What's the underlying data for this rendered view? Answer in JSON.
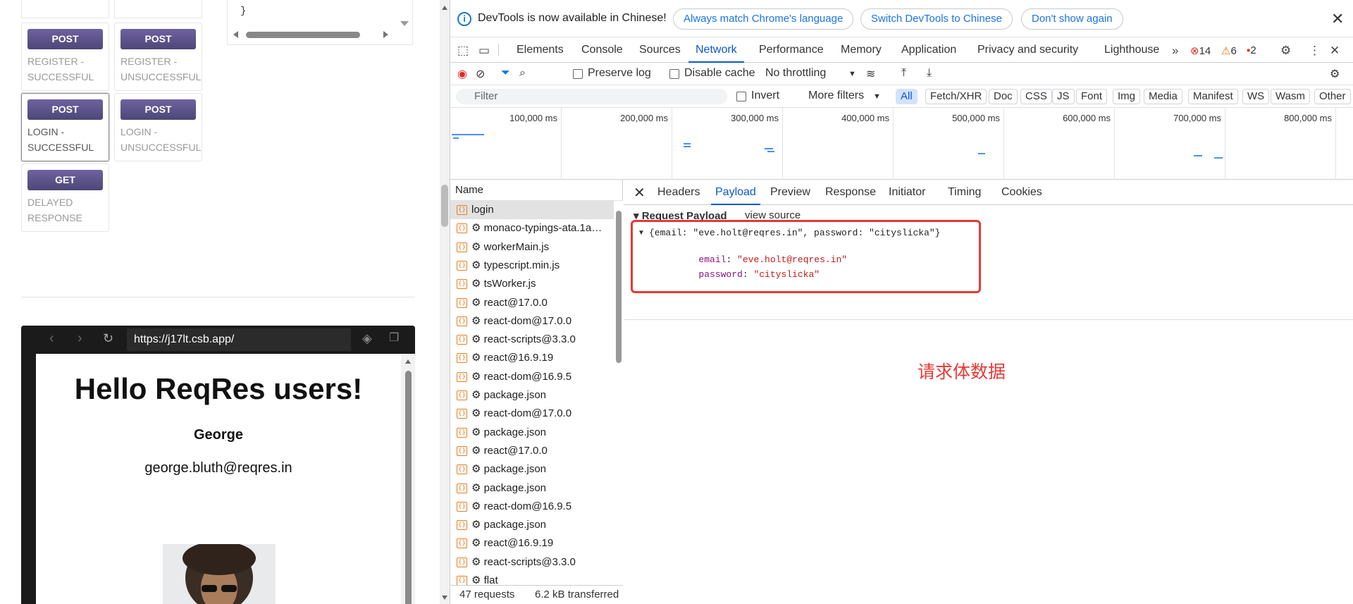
{
  "left_page": {
    "code_tail": "}",
    "endpoints": [
      {
        "method": "POST",
        "label": "REGISTER - SUCCESSFUL"
      },
      {
        "method": "POST",
        "label": "REGISTER - UNSUCCESSFUL"
      },
      {
        "method": "POST",
        "label": "LOGIN - SUCCESSFUL"
      },
      {
        "method": "POST",
        "label": "LOGIN - UNSUCCESSFUL"
      },
      {
        "method": "GET",
        "label": "DELAYED RESPONSE"
      }
    ],
    "sandbox": {
      "url": "https://j17lt.csb.app/",
      "title": "Hello ReqRes users!",
      "user_name": "George",
      "user_email": "george.bluth@reqres.in"
    }
  },
  "devtools": {
    "infobar": {
      "text": "DevTools is now available in Chinese!",
      "btn_match": "Always match Chrome's language",
      "btn_switch": "Switch DevTools to Chinese",
      "btn_dont_show": "Don't show again"
    },
    "tabs": [
      "Elements",
      "Console",
      "Sources",
      "Network",
      "Performance",
      "Memory",
      "Application",
      "Privacy and security",
      "Lighthouse"
    ],
    "active_tab": "Network",
    "counts": {
      "errors": "14",
      "warnings": "6",
      "issues": "2"
    },
    "toolbar": {
      "preserve_log": "Preserve log",
      "disable_cache": "Disable cache",
      "throttling": "No throttling"
    },
    "filter": {
      "placeholder": "Filter",
      "invert": "Invert",
      "more_filters": "More filters",
      "types": [
        "All",
        "Fetch/XHR",
        "Doc",
        "CSS",
        "JS",
        "Font",
        "Img",
        "Media",
        "Manifest",
        "WS",
        "Wasm",
        "Other"
      ]
    },
    "overview_ticks": [
      "100,000 ms",
      "200,000 ms",
      "300,000 ms",
      "400,000 ms",
      "500,000 ms",
      "600,000 ms",
      "700,000 ms",
      "800,000 ms"
    ],
    "name_header": "Name",
    "requests": [
      "login",
      "⚙ monaco-typings-ata.1a…",
      "⚙ workerMain.js",
      "⚙ typescript.min.js",
      "⚙ tsWorker.js",
      "⚙ react@17.0.0",
      "⚙ react-dom@17.0.0",
      "⚙ react-scripts@3.3.0",
      "⚙ react@16.9.19",
      "⚙ react-dom@16.9.5",
      "⚙ package.json",
      "⚙ react-dom@17.0.0",
      "⚙ package.json",
      "⚙ react@17.0.0",
      "⚙ package.json",
      "⚙ package.json",
      "⚙ react-dom@16.9.5",
      "⚙ package.json",
      "⚙ react@16.9.19",
      "⚙ react-scripts@3.3.0",
      "⚙ flat"
    ],
    "status": {
      "requests": "47 requests",
      "transferred": "6.2 kB transferred"
    },
    "detail_tabs": [
      "Headers",
      "Payload",
      "Preview",
      "Response",
      "Initiator",
      "Timing",
      "Cookies"
    ],
    "active_detail_tab": "Payload",
    "payload": {
      "heading": "▾ Request Payload",
      "view_source": "view source",
      "summary": "{email: \"eve.holt@reqres.in\", password: \"cityslicka\"}",
      "email_key": "email",
      "email_value": "\"eve.holt@reqres.in\"",
      "password_key": "password",
      "password_value": "\"cityslicka\""
    },
    "annotation": "请求体数据"
  }
}
